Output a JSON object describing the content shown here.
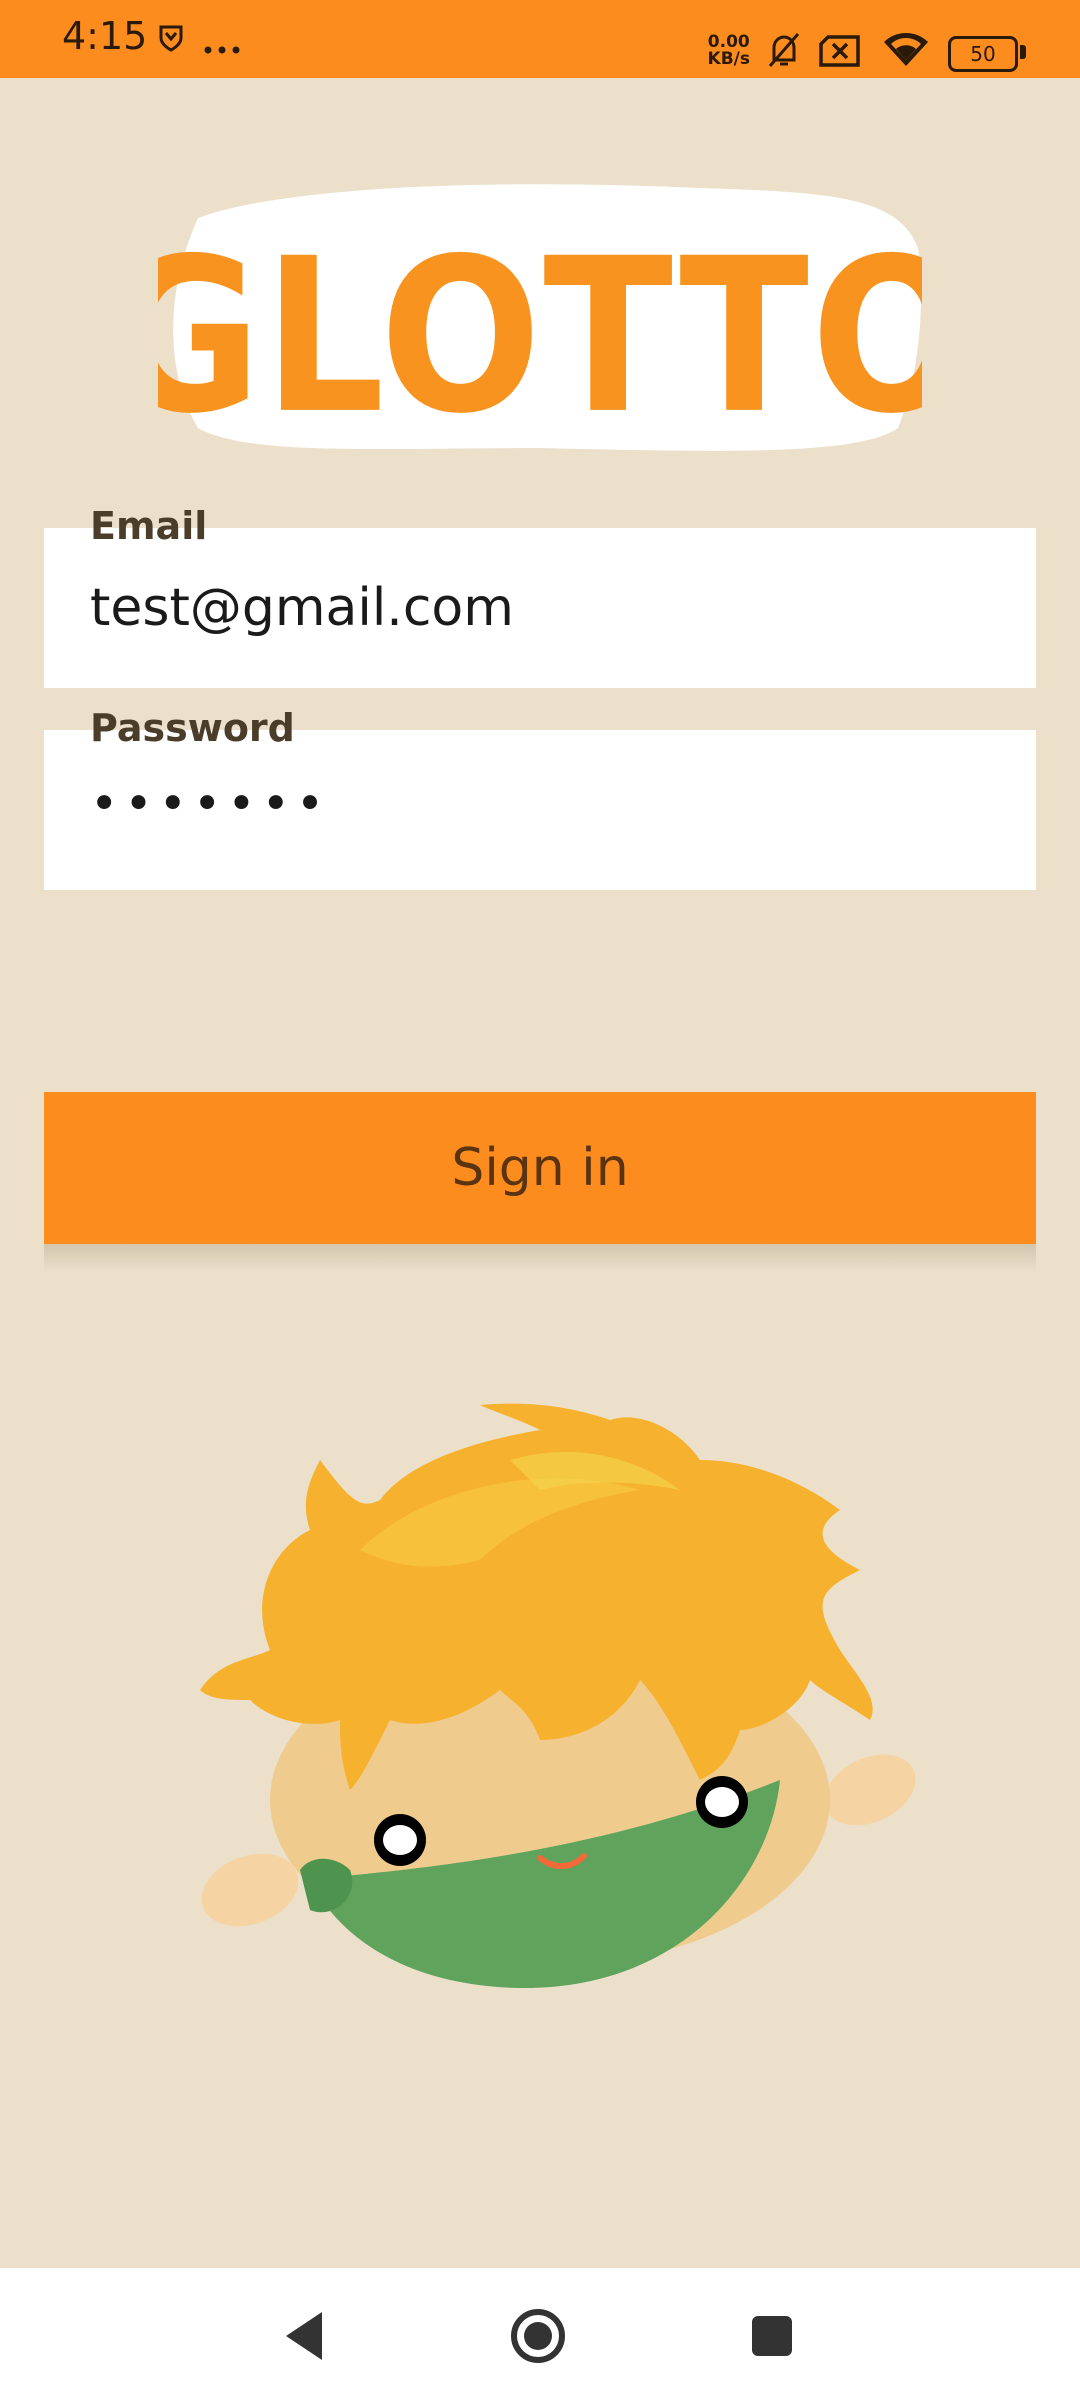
{
  "status_bar": {
    "time": "4:15",
    "net_speed_value": "0.00",
    "net_speed_unit": "KB/s",
    "battery": "50",
    "icons": [
      "shield-icon",
      "more-dots-icon",
      "mute-bell-icon",
      "no-sim-icon",
      "wifi-icon",
      "battery-icon"
    ]
  },
  "logo": {
    "text": "GLOTTO"
  },
  "form": {
    "email": {
      "label": "Email",
      "value": "test@gmail.com"
    },
    "password": {
      "label": "Password",
      "value": "•••••••"
    }
  },
  "sign_in": {
    "label": "Sign in"
  },
  "nav": {
    "icons": [
      "back-triangle-icon",
      "home-circle-icon",
      "recent-square-icon"
    ]
  },
  "colors": {
    "accent": "#FD8C1E",
    "background": "#ECE0CA",
    "field": "#FFFFFF",
    "button_text": "#5a3410"
  }
}
